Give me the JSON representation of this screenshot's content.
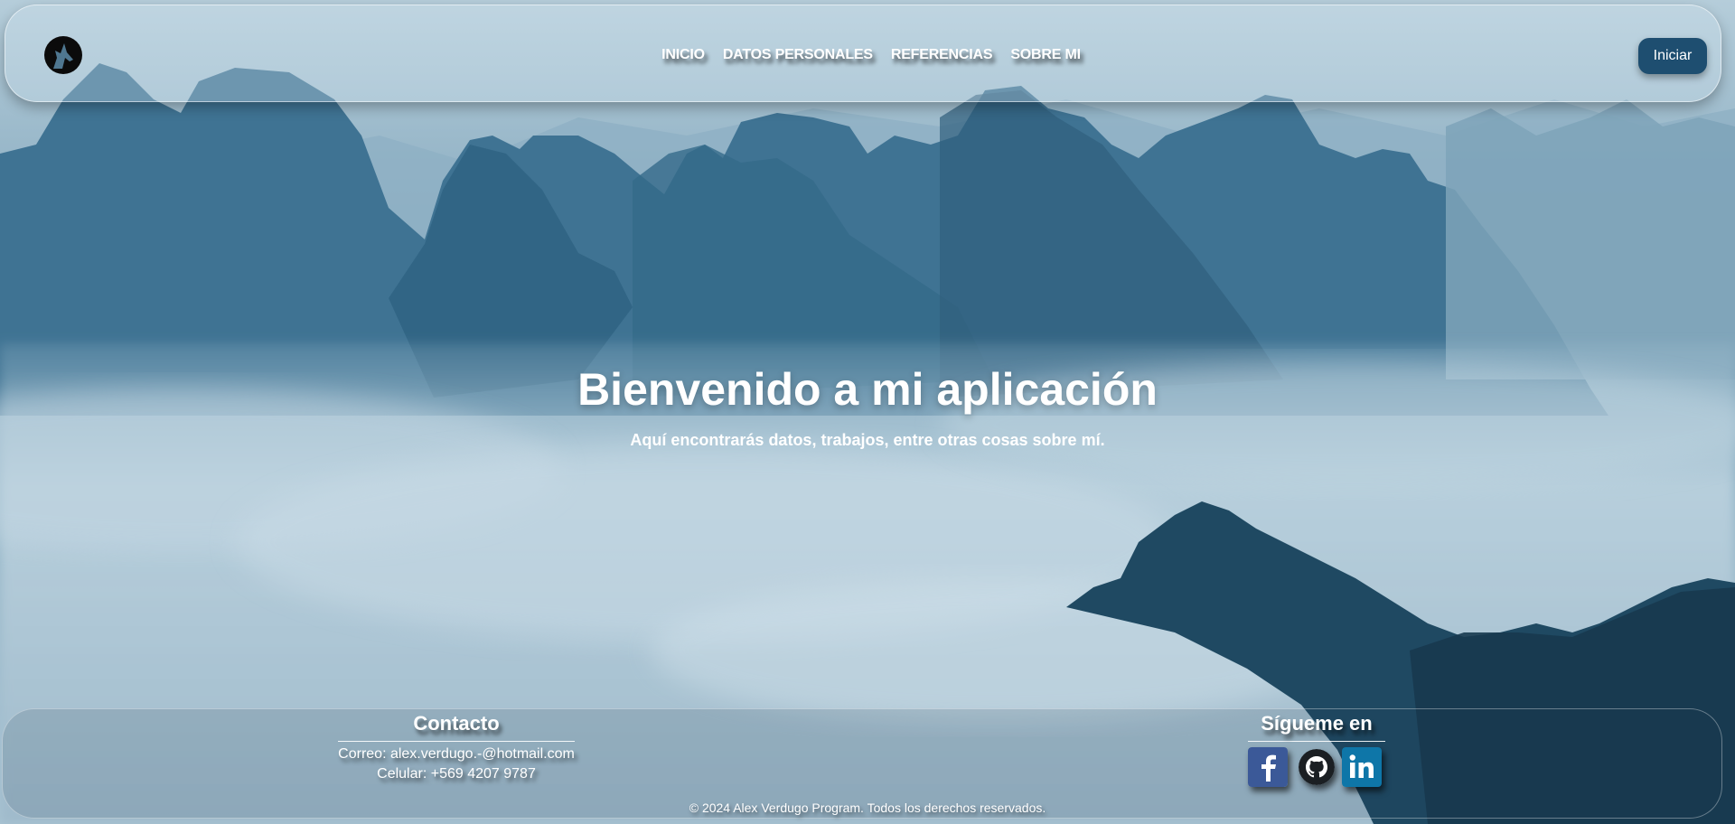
{
  "header": {
    "logo_icon": "wolf-howl-icon",
    "nav": [
      {
        "label": "INICIO"
      },
      {
        "label": "DATOS PERSONALES"
      },
      {
        "label": "REFERENCIAS"
      },
      {
        "label": "SOBRE MI"
      }
    ],
    "login_label": "Iniciar"
  },
  "hero": {
    "title": "Bienvenido a mi aplicación",
    "subtitle": "Aquí encontrarás datos, trabajos, entre otras cosas sobre mí.",
    "background": "misty-mountains-image"
  },
  "footer": {
    "contact": {
      "title": "Contacto",
      "email": "Correo: alex.verdugo.-@hotmail.com",
      "phone": "Celular: +569 4207 9787"
    },
    "social": {
      "title": "Sígueme en",
      "icons": [
        "facebook-icon",
        "github-icon",
        "linkedin-icon"
      ]
    },
    "copyright": "© 2024 Alex Verdugo Program. Todos los derechos reservados."
  },
  "colors": {
    "accent_button": "#1e4e70",
    "facebook": "#3b5998",
    "linkedin": "#0e76a8",
    "github": "#1b1f23"
  }
}
